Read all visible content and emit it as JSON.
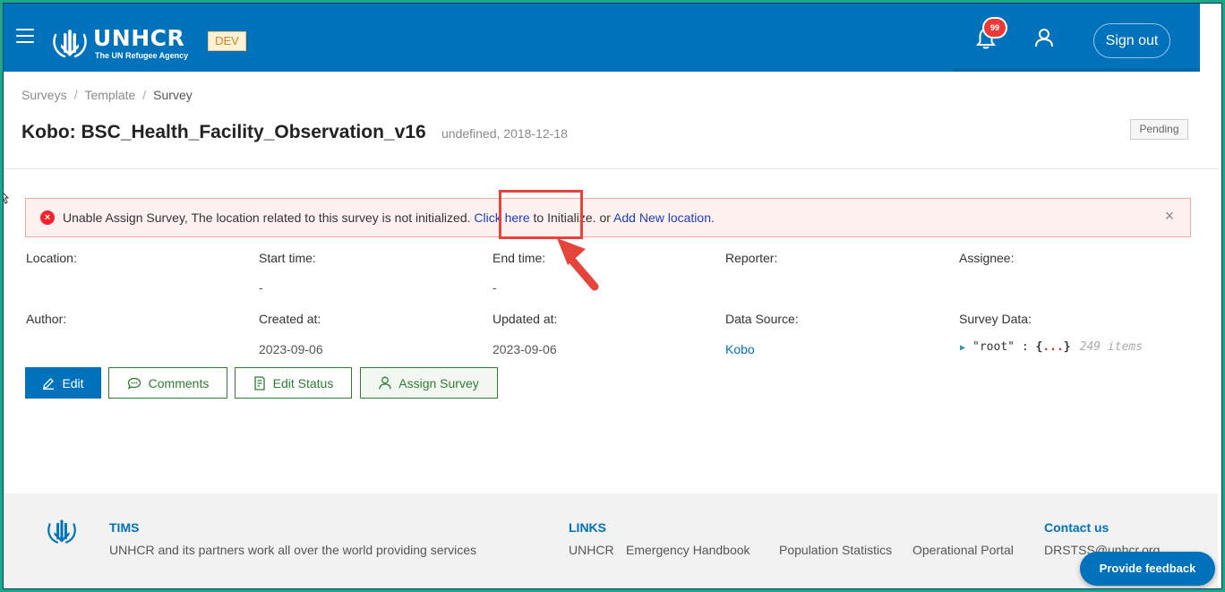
{
  "header": {
    "logo_text": "UNHCR",
    "logo_sub": "The UN Refugee Agency",
    "env_badge": "DEV",
    "notification_count": "99",
    "sign_out_label": "Sign out",
    "brand_color": "#0072bc"
  },
  "breadcrumb": {
    "items": [
      "Surveys",
      "Template",
      "Survey"
    ],
    "separator": "/"
  },
  "page": {
    "title": "Kobo: BSC_Health_Facility_Observation_v16",
    "meta": "undefined, 2018-12-18",
    "status": "Pending"
  },
  "alert": {
    "text_before": "Unable Assign Survey, The location related to this survey is not initialized.",
    "link1": "Click here",
    "text_middle": "to Initialize. or",
    "link2": "Add New location.",
    "close": "×",
    "error_icon": "×"
  },
  "details": {
    "row1": [
      {
        "label": "Location",
        "value": ""
      },
      {
        "label": "Start time",
        "value": "-"
      },
      {
        "label": "End time",
        "value": "-"
      },
      {
        "label": "Reporter",
        "value": ""
      },
      {
        "label": "Assignee",
        "value": ""
      }
    ],
    "row2": [
      {
        "label": "Author",
        "value": ""
      },
      {
        "label": "Created at",
        "value": "2023-09-06"
      },
      {
        "label": "Updated at",
        "value": "2023-09-06"
      },
      {
        "label": "Data Source",
        "value": "Kobo"
      },
      {
        "label": "Survey Data",
        "value": ""
      }
    ],
    "label_suffix": ":",
    "survey_data": {
      "key": "\"root\"",
      "colon": ":",
      "open": "{",
      "dots": "...",
      "close": "}",
      "count": "249 items"
    }
  },
  "actions": {
    "edit": "Edit",
    "comments": "Comments",
    "edit_status": "Edit Status",
    "assign_survey": "Assign Survey"
  },
  "footer": {
    "tims_heading": "TIMS",
    "tims_text": "UNHCR and its partners work all over the world providing services",
    "links_heading": "LINKS",
    "links": [
      "UNHCR",
      "Emergency Handbook",
      "Population Statistics",
      "Operational Portal"
    ],
    "contact_heading": "Contact us",
    "contact_email": "DRSTSS@unhcr.org",
    "feedback_label": "Provide feedback"
  }
}
